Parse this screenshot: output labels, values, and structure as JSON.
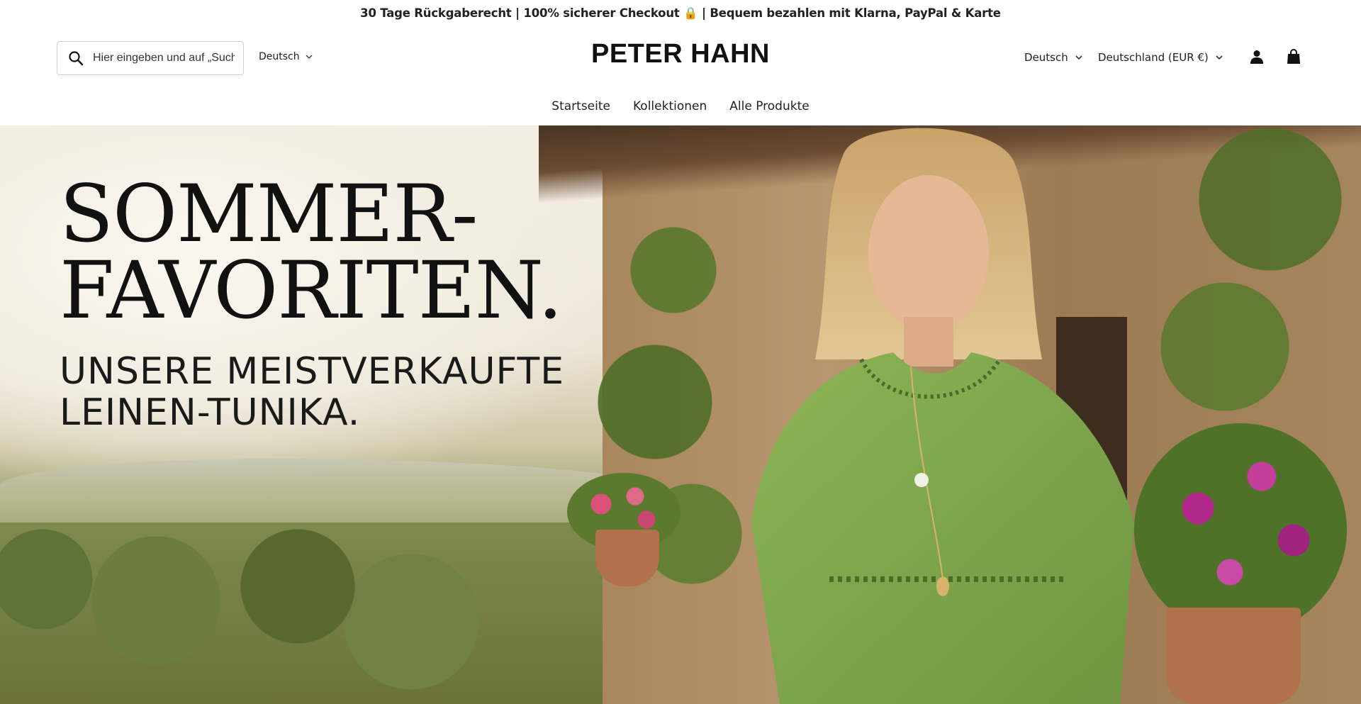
{
  "announcement": {
    "text": "30 Tage Rückgaberecht | 100% sicherer Checkout 🔒 | Bequem bezahlen mit Klarna, PayPal & Karte"
  },
  "header": {
    "search": {
      "placeholder": "Hier eingeben und auf „Suche“ drücken",
      "icon": "search-icon"
    },
    "language_left": "Deutsch",
    "logo": "PETER HAHN",
    "language_right": "Deutsch",
    "country": "Deutschland (EUR €)",
    "account_icon": "account-icon",
    "cart_icon": "cart-icon"
  },
  "nav": {
    "items": [
      {
        "label": "Startseite"
      },
      {
        "label": "Kollektionen"
      },
      {
        "label": "Alle Produkte"
      }
    ]
  },
  "hero": {
    "title_line1": "SOMMER-",
    "title_line2": "FAVORITEN.",
    "subtitle_line1": "UNSERE MEISTVERKAUFTE",
    "subtitle_line2": "LEINEN-TUNIKA."
  },
  "colors": {
    "text": "#1a1a1a",
    "tunic_green": "#7ea64a",
    "background": "#ffffff"
  }
}
